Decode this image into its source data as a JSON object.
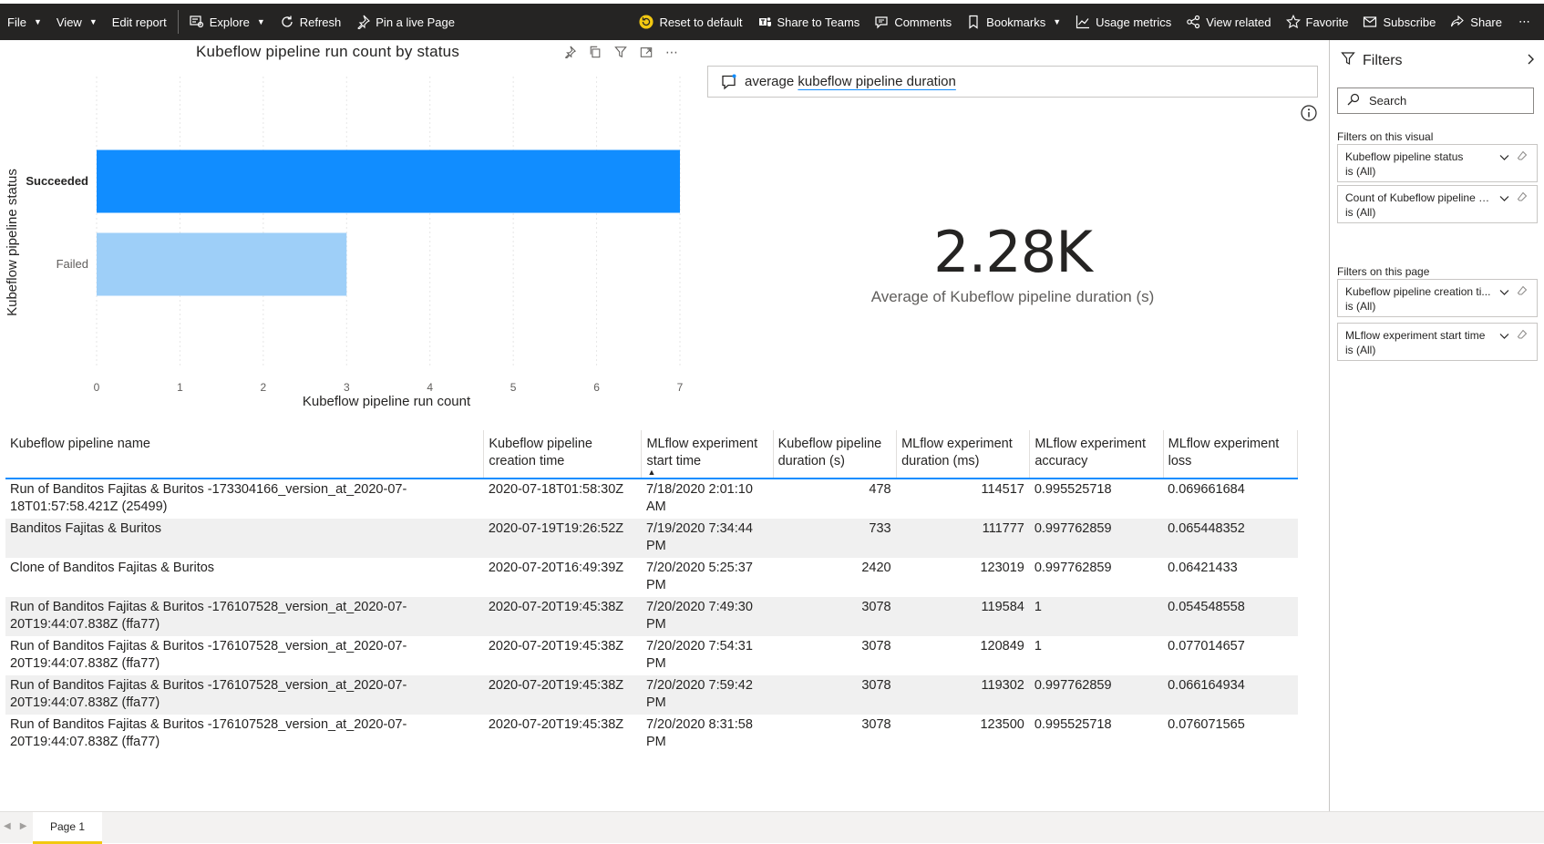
{
  "toolbar": {
    "file": "File",
    "view": "View",
    "edit_report": "Edit report",
    "explore": "Explore",
    "refresh": "Refresh",
    "pin_live": "Pin a live Page",
    "reset_default": "Reset to default",
    "share_teams": "Share to Teams",
    "comments": "Comments",
    "bookmarks": "Bookmarks",
    "usage_metrics": "Usage metrics",
    "view_related": "View related",
    "favorite": "Favorite",
    "subscribe": "Subscribe",
    "share": "Share"
  },
  "chart_data": {
    "type": "bar",
    "orientation": "horizontal",
    "title": "Kubeflow pipeline run count by status",
    "xlabel": "Kubeflow pipeline run count",
    "ylabel": "Kubeflow pipeline status",
    "categories": [
      "Succeeded",
      "Failed"
    ],
    "values": [
      7,
      3
    ],
    "colors": [
      "#118dff",
      "#9ecff8"
    ],
    "xlim": [
      0,
      7
    ],
    "xticks": [
      "0",
      "1",
      "2",
      "3",
      "4",
      "5",
      "6",
      "7"
    ],
    "grid": true
  },
  "qna": {
    "prefix": "average",
    "highlight": "kubeflow pipeline duration"
  },
  "kpi": {
    "value": "2.28K",
    "label": "Average of Kubeflow pipeline duration (s)"
  },
  "table": {
    "headers": [
      "Kubeflow pipeline name",
      "Kubeflow pipeline creation time",
      "MLflow experiment start time",
      "Kubeflow pipeline duration (s)",
      "MLflow experiment duration (ms)",
      "MLflow experiment accuracy",
      "MLflow experiment loss"
    ],
    "rows": [
      [
        "Run of Banditos Fajitas & Buritos -173304166_version_at_2020-07-18T01:57:58.421Z (25499)",
        "2020-07-18T01:58:30Z",
        "7/18/2020 2:01:10 AM",
        "478",
        "114517",
        "0.995525718",
        "0.069661684"
      ],
      [
        "Banditos Fajitas & Buritos",
        "2020-07-19T19:26:52Z",
        "7/19/2020 7:34:44 PM",
        "733",
        "111777",
        "0.997762859",
        "0.065448352"
      ],
      [
        "Clone of Banditos Fajitas & Buritos",
        "2020-07-20T16:49:39Z",
        "7/20/2020 5:25:37 PM",
        "2420",
        "123019",
        "0.997762859",
        "0.06421433"
      ],
      [
        "Run of Banditos Fajitas & Buritos -176107528_version_at_2020-07-20T19:44:07.838Z (ffa77)",
        "2020-07-20T19:45:38Z",
        "7/20/2020 7:49:30 PM",
        "3078",
        "119584",
        "1",
        "0.054548558"
      ],
      [
        "Run of Banditos Fajitas & Buritos -176107528_version_at_2020-07-20T19:44:07.838Z (ffa77)",
        "2020-07-20T19:45:38Z",
        "7/20/2020 7:54:31 PM",
        "3078",
        "120849",
        "1",
        "0.077014657"
      ],
      [
        "Run of Banditos Fajitas & Buritos -176107528_version_at_2020-07-20T19:44:07.838Z (ffa77)",
        "2020-07-20T19:45:38Z",
        "7/20/2020 7:59:42 PM",
        "3078",
        "119302",
        "0.997762859",
        "0.066164934"
      ],
      [
        "Run of Banditos Fajitas & Buritos -176107528_version_at_2020-07-20T19:44:07.838Z (ffa77)",
        "2020-07-20T19:45:38Z",
        "7/20/2020 8:31:58 PM",
        "3078",
        "123500",
        "0.995525718",
        "0.076071565"
      ]
    ]
  },
  "filters": {
    "title": "Filters",
    "search_placeholder": "Search",
    "visual_section": "Filters on this visual",
    "page_section": "Filters on this page",
    "visual_filters": [
      {
        "title": "Kubeflow pipeline status",
        "state": "is (All)"
      },
      {
        "title": "Count of Kubeflow pipeline s...",
        "state": "is (All)"
      }
    ],
    "page_filters": [
      {
        "title": "Kubeflow pipeline creation ti...",
        "state": "is (All)"
      },
      {
        "title": "MLflow experiment start time",
        "state": "is (All)"
      }
    ]
  },
  "pages": {
    "current": "Page 1"
  }
}
